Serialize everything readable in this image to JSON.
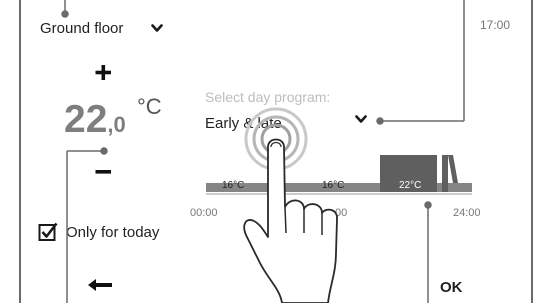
{
  "header": {
    "room": "Ground floor",
    "time": "17:00"
  },
  "temperature": {
    "integer": "22",
    "decimal": ",0",
    "unit": "°C",
    "plus_label": "+",
    "minus_label": "–"
  },
  "program": {
    "hint": "Select day program:",
    "selected": "Early & late"
  },
  "schedule": {
    "start_label": "00:00",
    "middle_label": "00",
    "end_label": "24:00",
    "temp_labels": [
      "16°C",
      "16°C",
      "22°C"
    ],
    "colors": {
      "low": "#858585",
      "high": "#5f5f5f"
    }
  },
  "today": {
    "label": "Only for today",
    "checked": true
  },
  "footer": {
    "ok_label": "OK"
  },
  "icons": [
    "chevron-down-icon",
    "plus-icon",
    "minus-icon",
    "checkbox-icon",
    "back-arrow-icon",
    "hand-tap-icon"
  ]
}
